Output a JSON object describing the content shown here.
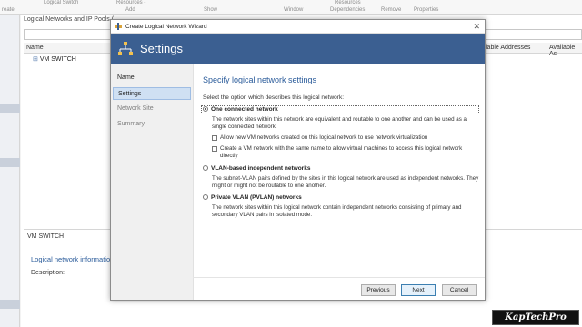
{
  "ribbon": {
    "items": [
      {
        "label": "reate"
      },
      {
        "label": "Logical Switch"
      },
      {
        "label": "Add"
      },
      {
        "label": "Resources -"
      },
      {
        "label": "Show"
      },
      {
        "label": "Window"
      },
      {
        "label": "Resources"
      },
      {
        "label": "Dependencies"
      },
      {
        "label": "Remove"
      },
      {
        "label": "Properties"
      }
    ]
  },
  "background": {
    "panel_title": "Logical Networks and IP Pools (",
    "columns": {
      "name": "Name",
      "available_addresses": "lable Addresses",
      "available": "Available Ac"
    },
    "row": "VM SWITCH",
    "bottom_title": "VM SWITCH",
    "detail_title": "Logical network informatio",
    "description_label": "Description:"
  },
  "wizard": {
    "title": "Create Logical Network Wizard",
    "close": "✕",
    "banner": "Settings",
    "steps": [
      {
        "label": "Name"
      },
      {
        "label": "Settings"
      },
      {
        "label": "Network Site"
      },
      {
        "label": "Summary"
      }
    ],
    "heading": "Specify logical network settings",
    "prompt": "Select the option which describes this logical network:",
    "options": [
      {
        "label": "One connected network",
        "selected": true,
        "description": "The network sites within this network are equivalent and routable to one another and can be used as a single connected network.",
        "checkboxes": [
          {
            "label": "Allow new VM networks created on this logical network to use network virtualization",
            "checked": false
          },
          {
            "label": "Create a VM network with the same name to allow virtual machines to access this logical network directly",
            "checked": false
          }
        ]
      },
      {
        "label": "VLAN-based independent networks",
        "selected": false,
        "description": "The subnet-VLAN pairs defined by the sites in this logical network are used as independent networks. They might or might not be routable to one another."
      },
      {
        "label": "Private VLAN (PVLAN) networks",
        "selected": false,
        "description": "The network sites within this logical network contain independent networks consisting of primary and secondary VLAN pairs in isolated mode."
      }
    ],
    "buttons": {
      "previous": "Previous",
      "next": "Next",
      "cancel": "Cancel"
    },
    "colors": {
      "banner": "#3b5f91",
      "heading": "#2a5b9a",
      "selected_step": "#cfe0f3"
    }
  },
  "watermark": "KapTechPro"
}
